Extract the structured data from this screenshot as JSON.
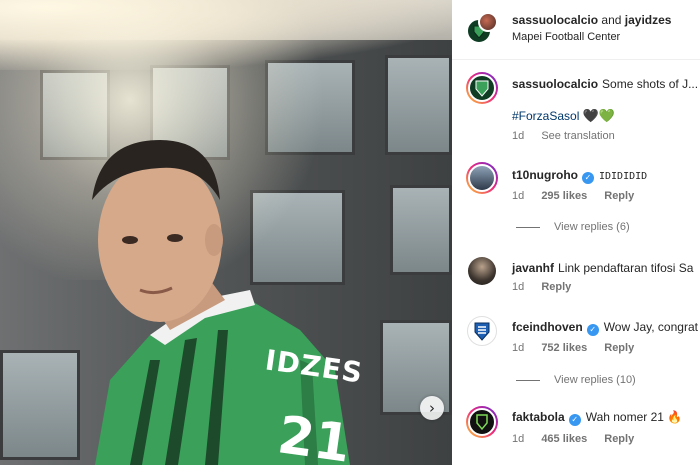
{
  "post": {
    "photo_alt": "Player posing in green striped jersey",
    "jersey_text": "IDZES",
    "jersey_number": "21",
    "next_icon": "chevron-right-icon",
    "next_glyph": "›"
  },
  "header": {
    "user1": "sassuolocalcio",
    "and_text": "and",
    "user2": "jayidzes",
    "location": "Mapei Football Center"
  },
  "caption": {
    "username": "sassuolocalcio",
    "text": "Some shots of J...",
    "hashtag": "#ForzaSasol",
    "emojis": [
      "🖤",
      "💚"
    ],
    "time": "1d",
    "see_translation": "See translation"
  },
  "comments": [
    {
      "username": "t10nugroho",
      "verified": true,
      "text": "IDIDIDID",
      "time": "1d",
      "likes": "295 likes",
      "reply": "Reply",
      "view_replies": "View replies (6)"
    },
    {
      "username": "javanhf",
      "verified": false,
      "text": "Link pendaftaran tifosi Sa",
      "time": "1d",
      "reply": "Reply"
    },
    {
      "username": "fceindhoven",
      "verified": true,
      "text": "Wow Jay, congrat",
      "time": "1d",
      "likes": "752 likes",
      "reply": "Reply",
      "view_replies": "View replies (10)"
    },
    {
      "username": "faktabola",
      "verified": true,
      "text": "Wah nomer 21",
      "emoji": "🔥",
      "time": "1d",
      "likes": "465 likes",
      "reply": "Reply"
    }
  ],
  "colors": {
    "verified": "#3897f0",
    "hashtag": "#00376b",
    "jersey_green": "#3aa05a",
    "muted_text": "#737373"
  }
}
